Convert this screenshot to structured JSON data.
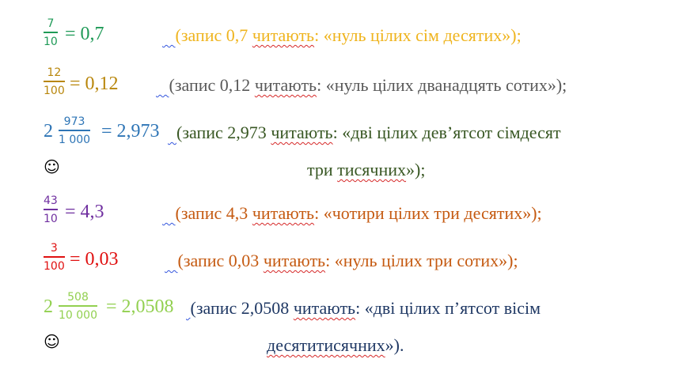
{
  "colors": {
    "green": "#1f9a57",
    "yellow": "#efb41e",
    "olive": "#b8860b",
    "gray": "#595959",
    "blue": "#2e75b6",
    "dark_green": "#385723",
    "purple": "#7030a0",
    "orange": "#c55a11",
    "red": "#e01010",
    "light_green": "#92d050",
    "navy": "#1f3864"
  },
  "lines": [
    {
      "whole": "",
      "numerator": "7",
      "denominator": "10",
      "equals": "= 0,7",
      "note": [
        "(запис 0,7 ",
        "читають",
        ": «нуль цілих сім десятих»);"
      ]
    },
    {
      "whole": "",
      "numerator": "12",
      "denominator": "100",
      "equals": "= 0,12",
      "note": [
        "(запис 0,12 ",
        "читають",
        ": «нуль цілих дванадцять сотих»);"
      ]
    },
    {
      "whole": "2",
      "numerator": "973",
      "denominator": "1 000",
      "equals": "= 2,973",
      "note": [
        "(запис 2,973 ",
        "читають",
        ": «дві цілих дев’ятсот сімдесят"
      ],
      "note_cont": [
        "три ",
        "тисячних",
        "»);"
      ]
    },
    {
      "whole": "",
      "numerator": "43",
      "denominator": "10",
      "equals": "= 4,3",
      "note": [
        "(запис 4,3 ",
        "читають",
        ": «чотири цілих три десятих»);"
      ]
    },
    {
      "whole": "",
      "numerator": "3",
      "denominator": "100",
      "equals": "= 0,03",
      "note": [
        "(запис 0,03 ",
        "читають",
        ": «нуль цілих три сотих»);"
      ]
    },
    {
      "whole": "2",
      "numerator": "508",
      "denominator": "10 000",
      "equals": "= 2,0508",
      "note": [
        "(запис 2,0508 ",
        "читають",
        ": «дві цілих п’ятсот вісім"
      ],
      "note_cont": [
        "десятитисячних",
        "»)."
      ]
    }
  ],
  "smiley": "☺"
}
